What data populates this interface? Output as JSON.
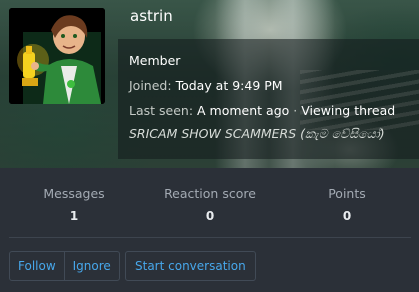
{
  "profile": {
    "username": "astrin",
    "user_title": "Member",
    "joined_label": "Joined:",
    "joined_value": "Today at 9:49 PM",
    "last_seen_label": "Last seen:",
    "last_seen_value": "A moment ago",
    "separator": "·",
    "activity": "Viewing thread",
    "signature": "SRICAM SHOW SCAMMERS (කැම වේසියෝ)"
  },
  "stats": [
    {
      "label": "Messages",
      "value": "1"
    },
    {
      "label": "Reaction score",
      "value": "0"
    },
    {
      "label": "Points",
      "value": "0"
    }
  ],
  "actions": {
    "follow": "Follow",
    "ignore": "Ignore",
    "start_conversation": "Start conversation"
  },
  "colors": {
    "background": "#2b3038",
    "link": "#47a7eb",
    "muted_text": "#a3aab3",
    "value_text": "#e9ecef"
  },
  "icons": {
    "avatar": "cartoon-character-avatar"
  }
}
